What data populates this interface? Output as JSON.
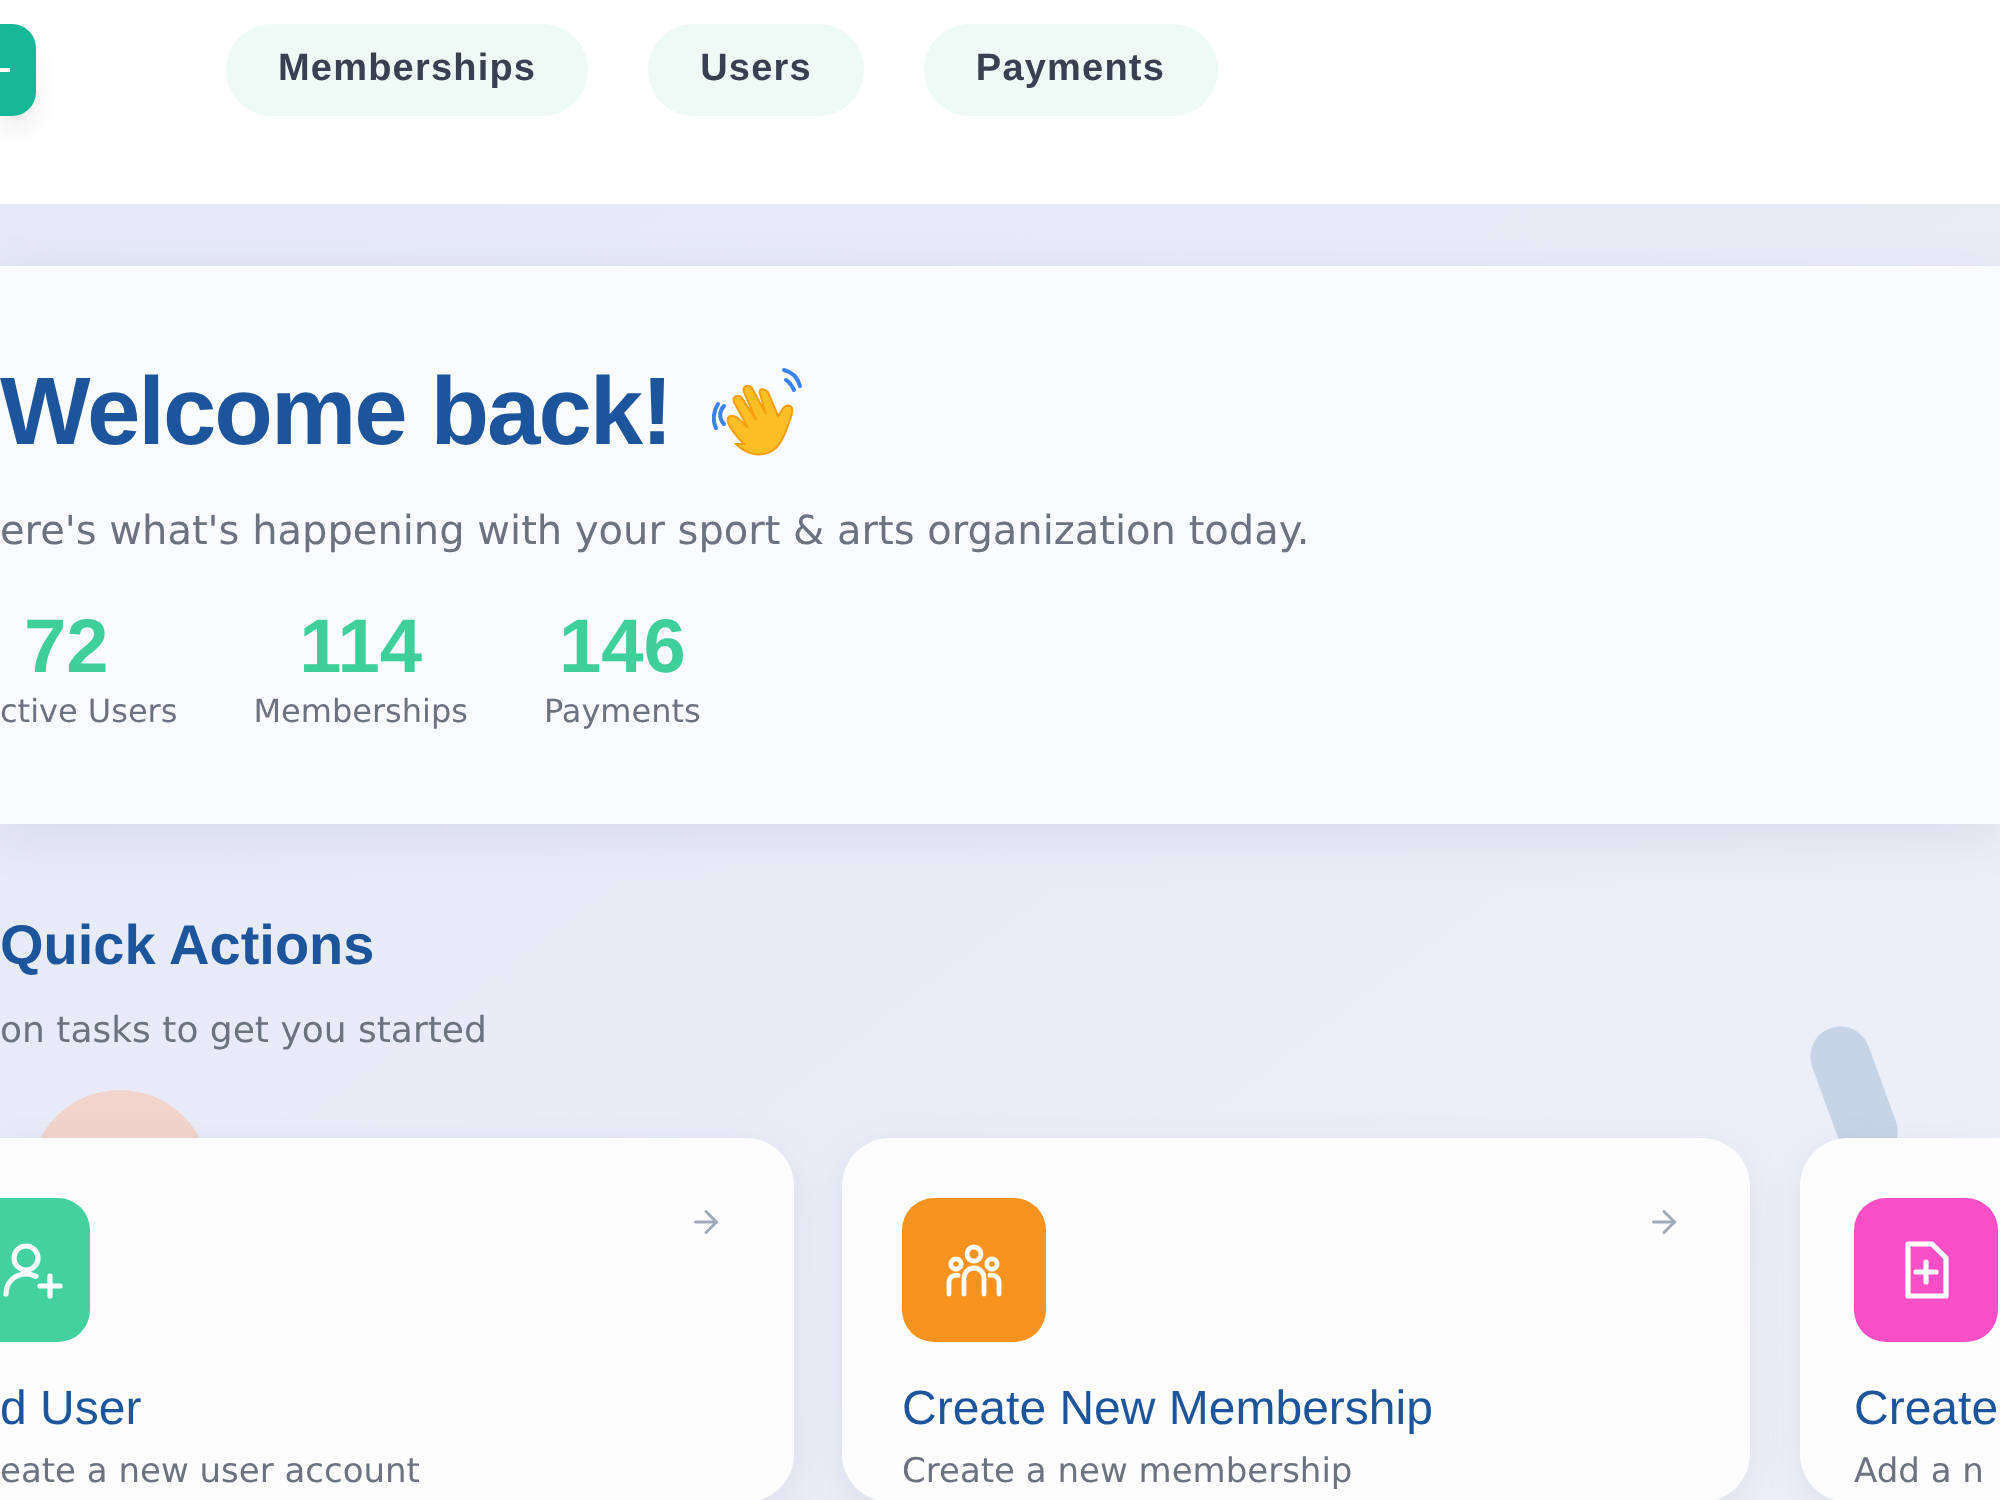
{
  "nav": [
    {
      "label": "Memberships",
      "selected": false
    },
    {
      "label": "Users",
      "selected": false
    },
    {
      "label": "Payments",
      "selected": false
    }
  ],
  "welcome": {
    "title": "Welcome back!",
    "subtitle": "ere's what's happening with your sport & arts organization today.",
    "stats": [
      {
        "value": "72",
        "label": "ctive Users"
      },
      {
        "value": "114",
        "label": "Memberships"
      },
      {
        "value": "146",
        "label": "Payments"
      }
    ]
  },
  "quick_actions": {
    "title": "Quick Actions",
    "subtitle": "on tasks to get you started",
    "cards": [
      {
        "kind": "add-user",
        "color": "#43d1a0",
        "title": "d User",
        "description": "eate a new user account"
      },
      {
        "kind": "membership",
        "color": "#f7931e",
        "title": "Create New Membership",
        "description": "Create a new membership"
      },
      {
        "kind": "document",
        "color": "#fb4fc8",
        "title": "Create",
        "description": "Add a n"
      }
    ]
  }
}
